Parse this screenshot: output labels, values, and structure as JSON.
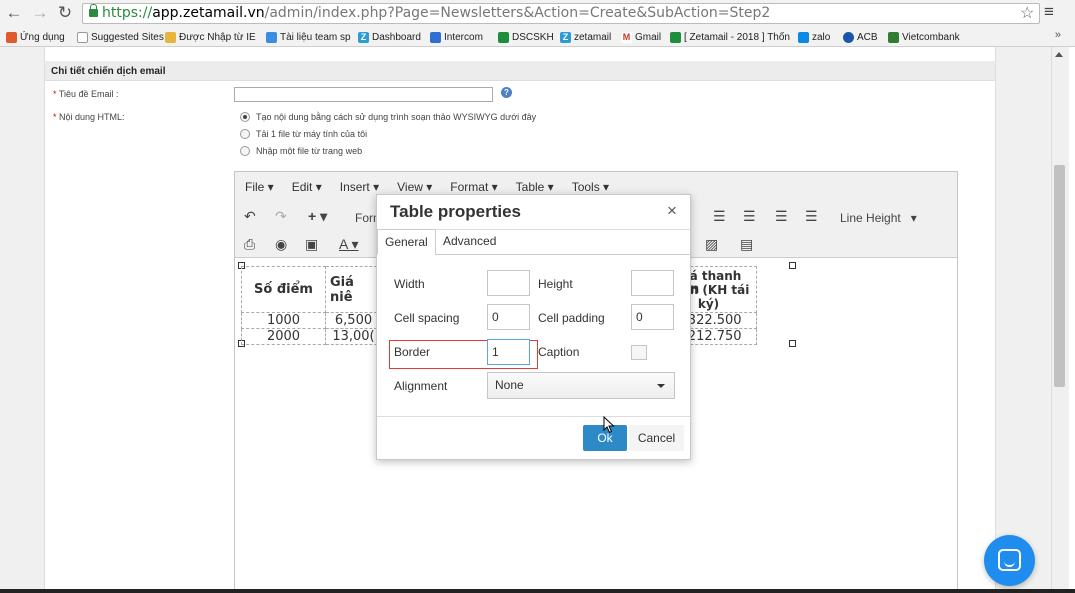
{
  "browser": {
    "url_scheme": "https://",
    "url_host": "app.zetamail.vn",
    "url_path": "/admin/index.php?Page=Newsletters&Action=Create&SubAction=Step2",
    "bookmarks": [
      {
        "label": "Ứng dụng",
        "icon": "apps-grid-icon",
        "color": "#e05a2b"
      },
      {
        "label": "Suggested Sites",
        "icon": "page-icon",
        "color": "#9a9a9a"
      },
      {
        "label": "Được Nhập từ IE",
        "icon": "folder-icon",
        "color": "#e8b53c"
      },
      {
        "label": "Tài liệu team sp",
        "icon": "google-drive-icon",
        "color": "#3b8de0"
      },
      {
        "label": "Dashboard",
        "icon": "zeta-icon",
        "color": "#2d9bd6"
      },
      {
        "label": "Intercom",
        "icon": "intercom-icon",
        "color": "#2f6fd1"
      },
      {
        "label": "DSCSKH",
        "icon": "sheets-icon",
        "color": "#1e8e3e"
      },
      {
        "label": "zetamail",
        "icon": "zeta-icon",
        "color": "#2d9bd6"
      },
      {
        "label": "Gmail",
        "icon": "gmail-icon",
        "color": "#d93025"
      },
      {
        "label": "[ Zetamail - 2018 ] Thốn",
        "icon": "sheets-icon",
        "color": "#1e8e3e"
      },
      {
        "label": "zalo",
        "icon": "zalo-icon",
        "color": "#0a8ae3"
      },
      {
        "label": "ACB",
        "icon": "acb-icon",
        "color": "#1a56a8"
      },
      {
        "label": "Vietcombank",
        "icon": "vietcombank-icon",
        "color": "#2e7d32"
      }
    ],
    "more": "»"
  },
  "form": {
    "section_title": "Chi tiết chiến dịch email",
    "subject_label": "Tiêu đề Email :",
    "html_label": "Nội dung HTML:",
    "required_mark": "*",
    "options": [
      {
        "label": "Tạo nội dung bằng cách sử dụng trình soạn thảo WYSIWYG dưới đây",
        "selected": true
      },
      {
        "label": "Tải 1 file từ máy tính của tôi",
        "selected": false
      },
      {
        "label": "Nhập một file từ trang web",
        "selected": false
      }
    ]
  },
  "editor": {
    "menu": [
      "File ▾",
      "Edit ▾",
      "Insert ▾",
      "View ▾",
      "Format ▾",
      "Table ▾",
      "Tools ▾"
    ],
    "format_label": "Form",
    "line_height_label": "Line Height",
    "table": {
      "headers": [
        "Số điểm",
        "Giá niê",
        "Giá thanh toán (KH tái ký)"
      ],
      "rows": [
        [
          "1000",
          "6,500",
          "4.322.500"
        ],
        [
          "2000",
          "13,00(",
          "8.212.750"
        ]
      ],
      "partial_char": "n"
    }
  },
  "dialog": {
    "title": "Table properties",
    "close": "×",
    "tabs": [
      "General",
      "Advanced"
    ],
    "fields": {
      "width_label": "Width",
      "width_value": "",
      "height_label": "Height",
      "height_value": "",
      "cell_spacing_label": "Cell spacing",
      "cell_spacing_value": "0",
      "cell_padding_label": "Cell padding",
      "cell_padding_value": "0",
      "border_label": "Border",
      "border_value": "1",
      "caption_label": "Caption",
      "caption_checked": false,
      "alignment_label": "Alignment",
      "alignment_value": "None"
    },
    "ok_label": "Ok",
    "cancel_label": "Cancel"
  },
  "colors": {
    "ok_button": "#2d8ac7",
    "highlight": "#e53935",
    "chat_button": "#1f8ded"
  }
}
